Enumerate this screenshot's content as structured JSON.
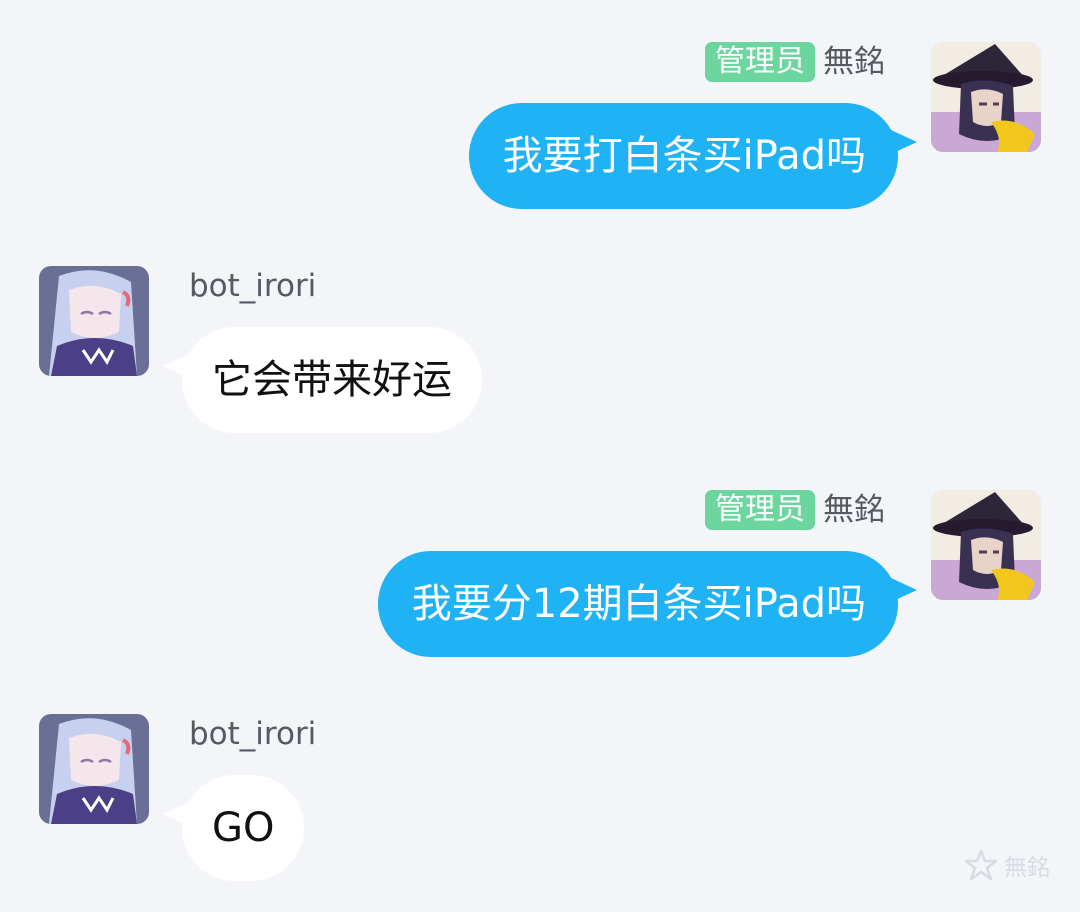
{
  "messages": [
    {
      "id": "m1",
      "direction": "outgoing",
      "role_badge": "管理员",
      "sender": "無銘",
      "text": "我要打白条买iPad吗"
    },
    {
      "id": "m2",
      "direction": "incoming",
      "sender": "bot_irori",
      "text": "它会带来好运"
    },
    {
      "id": "m3",
      "direction": "outgoing",
      "role_badge": "管理员",
      "sender": "無銘",
      "text": "我要分12期白条买iPad吗"
    },
    {
      "id": "m4",
      "direction": "incoming",
      "sender": "bot_irori",
      "text": "GO"
    }
  ],
  "watermark": {
    "text": "無銘",
    "icon": "star-logo-icon"
  },
  "colors": {
    "background": "#f3f5f9",
    "outgoing_bubble": "#1fb2f4",
    "incoming_bubble": "#ffffff",
    "role_badge": "#6dd59e"
  }
}
